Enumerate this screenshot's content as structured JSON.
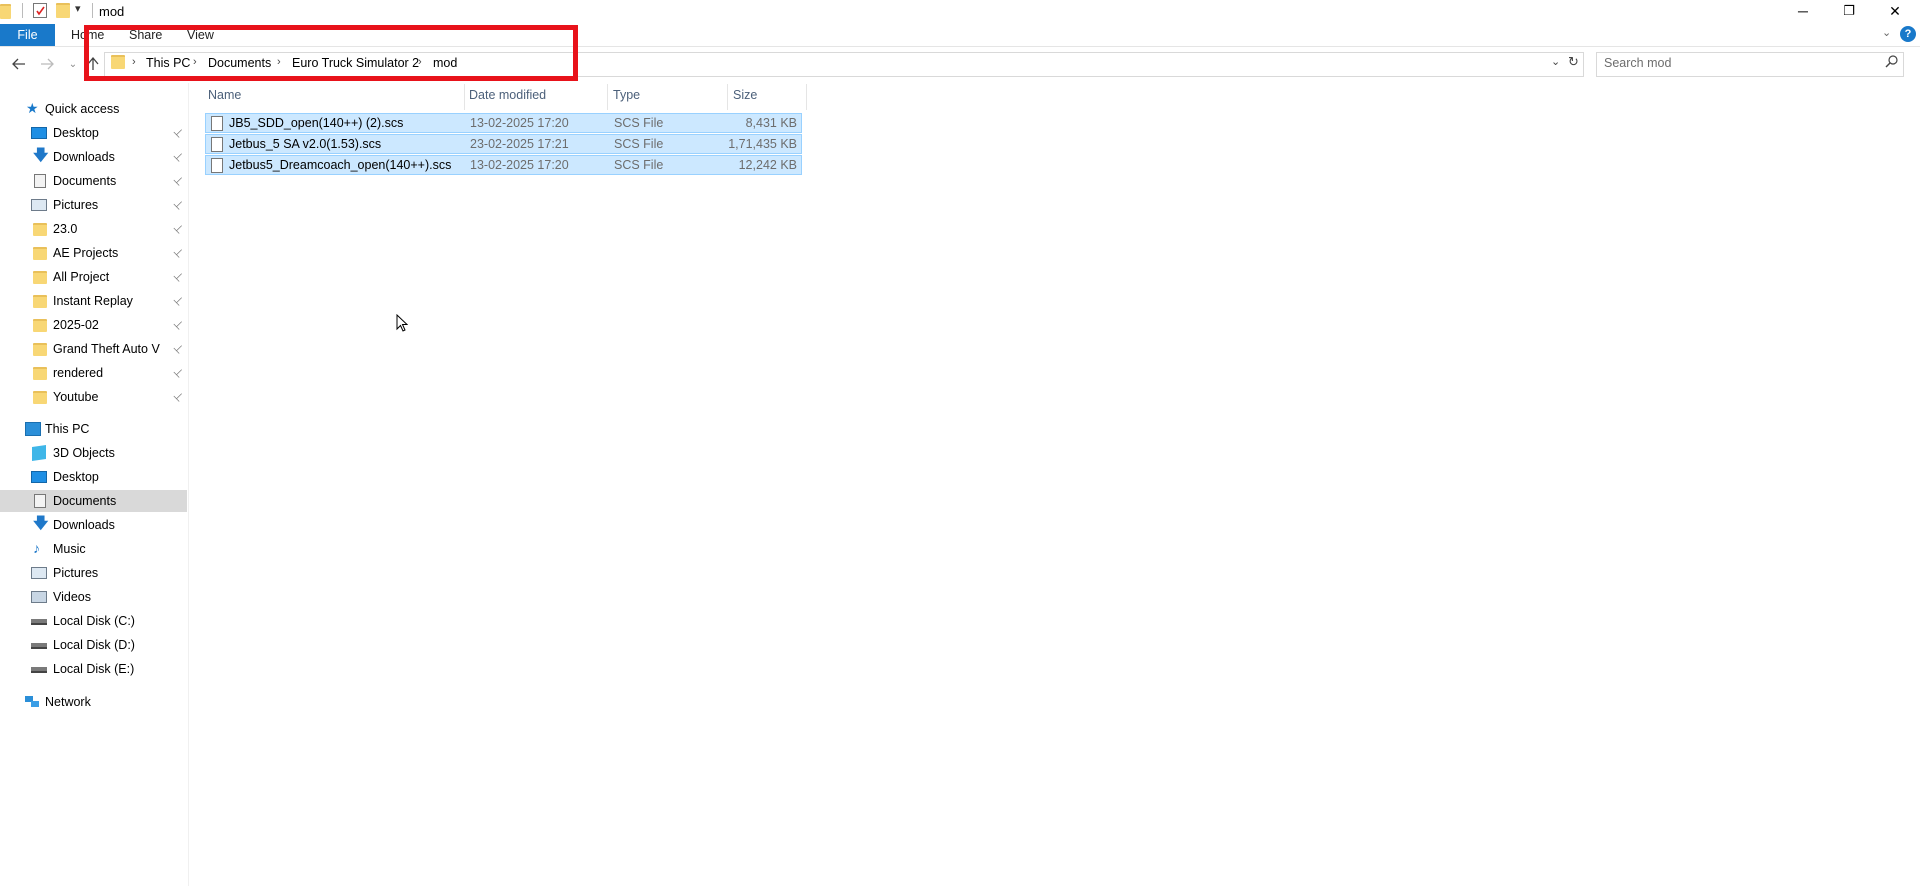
{
  "window": {
    "title": "mod",
    "controls": {
      "minimize": "─",
      "restore": "❐",
      "close": "✕"
    }
  },
  "ribbon": {
    "tabs": [
      {
        "label": "File"
      },
      {
        "label": "Home"
      },
      {
        "label": "Share"
      },
      {
        "label": "View"
      }
    ],
    "help": "?"
  },
  "address": {
    "crumbs": [
      "This PC",
      "Documents",
      "Euro Truck Simulator 2",
      "mod"
    ]
  },
  "search": {
    "placeholder": "Search mod"
  },
  "colors": {
    "accent": "#1979ca",
    "highlight": "#e8121a",
    "selection": "#cce8ff",
    "folder": "#f8d775"
  },
  "sidebar": {
    "quick_access": {
      "label": "Quick access",
      "items": [
        {
          "label": "Desktop",
          "icon": "desktop-icon"
        },
        {
          "label": "Downloads",
          "icon": "downloads-icon"
        },
        {
          "label": "Documents",
          "icon": "documents-icon"
        },
        {
          "label": "Pictures",
          "icon": "pictures-icon"
        },
        {
          "label": "23.0",
          "icon": "folder-icon"
        },
        {
          "label": "AE Projects",
          "icon": "folder-icon"
        },
        {
          "label": "All Project",
          "icon": "folder-icon"
        },
        {
          "label": "Instant Replay",
          "icon": "folder-icon"
        },
        {
          "label": "2025-02",
          "icon": "folder-icon"
        },
        {
          "label": "Grand Theft Auto V",
          "icon": "folder-icon"
        },
        {
          "label": "rendered",
          "icon": "folder-icon"
        },
        {
          "label": "Youtube",
          "icon": "folder-icon"
        }
      ]
    },
    "this_pc": {
      "label": "This PC",
      "items": [
        {
          "label": "3D Objects",
          "icon": "3d-objects-icon"
        },
        {
          "label": "Desktop",
          "icon": "desktop-icon"
        },
        {
          "label": "Documents",
          "icon": "documents-icon"
        },
        {
          "label": "Downloads",
          "icon": "downloads-icon"
        },
        {
          "label": "Music",
          "icon": "music-icon"
        },
        {
          "label": "Pictures",
          "icon": "pictures-icon"
        },
        {
          "label": "Videos",
          "icon": "videos-icon"
        },
        {
          "label": "Local Disk (C:)",
          "icon": "drive-icon"
        },
        {
          "label": "Local Disk (D:)",
          "icon": "drive-icon"
        },
        {
          "label": "Local Disk (E:)",
          "icon": "drive-icon"
        }
      ]
    },
    "network": {
      "label": "Network"
    }
  },
  "filelist": {
    "columns": [
      "Name",
      "Date modified",
      "Type",
      "Size"
    ],
    "rows": [
      {
        "name": "JB5_SDD_open(140++) (2).scs",
        "date": "13-02-2025 17:20",
        "type": "SCS File",
        "size": "8,431 KB"
      },
      {
        "name": "Jetbus_5 SA v2.0(1.53).scs",
        "date": "23-02-2025 17:21",
        "type": "SCS File",
        "size": "1,71,435 KB"
      },
      {
        "name": "Jetbus5_Dreamcoach_open(140++).scs",
        "date": "13-02-2025 17:20",
        "type": "SCS File",
        "size": "12,242 KB"
      }
    ]
  }
}
